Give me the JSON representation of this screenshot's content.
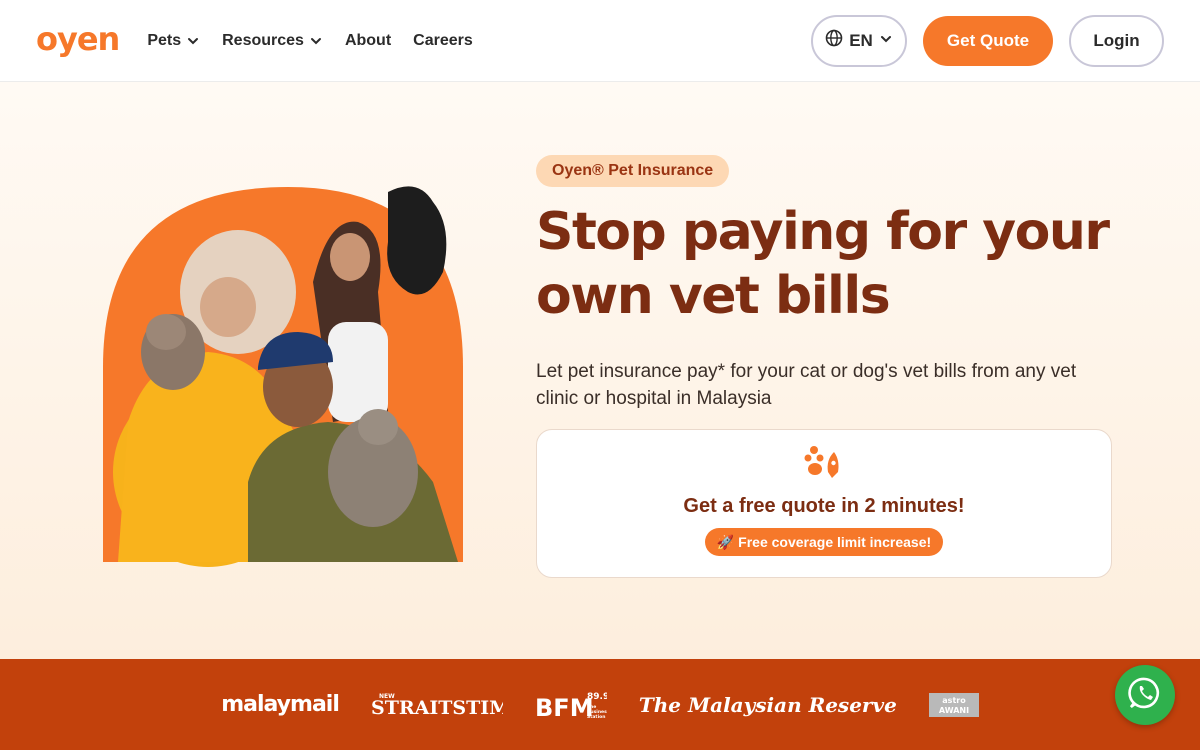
{
  "header": {
    "logo": "oyen",
    "nav": [
      {
        "label": "Pets",
        "has_dropdown": true
      },
      {
        "label": "Resources",
        "has_dropdown": true
      },
      {
        "label": "About",
        "has_dropdown": false
      },
      {
        "label": "Careers",
        "has_dropdown": false
      }
    ],
    "language": "EN",
    "get_quote_label": "Get Quote",
    "login_label": "Login"
  },
  "hero": {
    "badge": "Oyen® Pet Insurance",
    "headline": "Stop paying for your own vet bills",
    "subtext": "Let pet insurance pay* for your cat or dog's vet bills from any vet clinic or hospital in Malaysia",
    "card": {
      "icon": "paw-rocket-icon",
      "title": "Get a free quote in 2 minutes!",
      "promo": "🚀 Free coverage limit increase!"
    }
  },
  "press": {
    "logos": [
      "malaymail",
      "NEW STRAITS TIMES",
      "BFM 89.9 The Business Station",
      "The Malaysian Reserve",
      "astro AWANI"
    ]
  },
  "colors": {
    "brand_orange": "#f6782a",
    "headline_brown": "#7c2d12",
    "press_band": "#c2410c",
    "whatsapp_green": "#2fb14d"
  }
}
